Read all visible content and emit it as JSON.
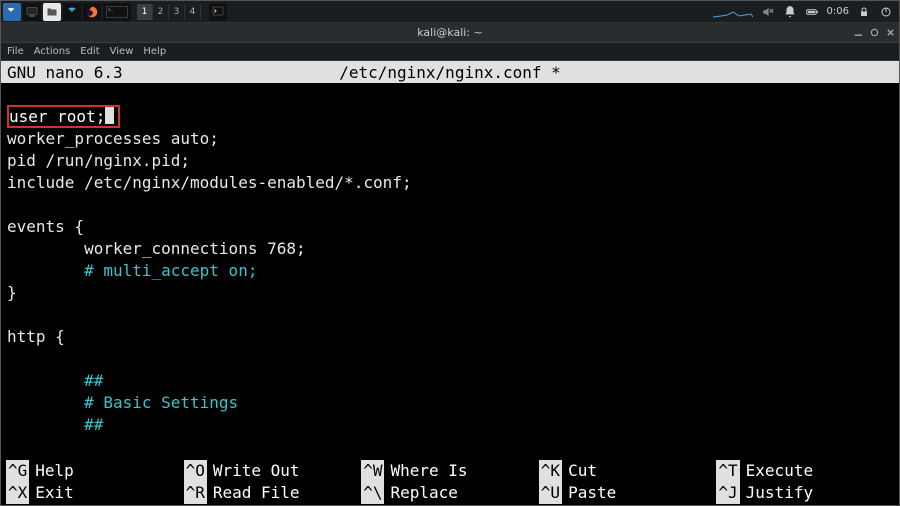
{
  "panel": {
    "workspaces": [
      "1",
      "2",
      "3",
      "4"
    ],
    "active_ws": 0,
    "clock": "0:06"
  },
  "window": {
    "title": "kali@kali: ~"
  },
  "menubar": [
    "File",
    "Actions",
    "Edit",
    "View",
    "Help"
  ],
  "nano": {
    "app": " GNU nano 6.3",
    "file": "/etc/nginx/nginx.conf *"
  },
  "editor": {
    "highlighted": "user root;",
    "lines": [
      {
        "t": "worker_processes auto;",
        "c": "plain"
      },
      {
        "t": "pid /run/nginx.pid;",
        "c": "plain"
      },
      {
        "t": "include /etc/nginx/modules-enabled/*.conf;",
        "c": "plain"
      },
      {
        "t": "",
        "c": "plain"
      },
      {
        "t": "events {",
        "c": "plain"
      },
      {
        "t": "        worker_connections 768;",
        "c": "plain"
      },
      {
        "t": "        # multi_accept on;",
        "c": "cyan"
      },
      {
        "t": "}",
        "c": "plain"
      },
      {
        "t": "",
        "c": "plain"
      },
      {
        "t": "http {",
        "c": "plain"
      },
      {
        "t": "",
        "c": "plain"
      },
      {
        "t": "        ##",
        "c": "cyan"
      },
      {
        "t": "        # Basic Settings",
        "c": "cyan"
      },
      {
        "t": "        ##",
        "c": "cyan"
      }
    ]
  },
  "shortcuts": [
    {
      "k": "^G",
      "l": "Help"
    },
    {
      "k": "^O",
      "l": "Write Out"
    },
    {
      "k": "^W",
      "l": "Where Is"
    },
    {
      "k": "^K",
      "l": "Cut"
    },
    {
      "k": "^T",
      "l": "Execute"
    },
    {
      "k": "^X",
      "l": "Exit"
    },
    {
      "k": "^R",
      "l": "Read File"
    },
    {
      "k": "^\\",
      "l": "Replace"
    },
    {
      "k": "^U",
      "l": "Paste"
    },
    {
      "k": "^J",
      "l": "Justify"
    }
  ]
}
